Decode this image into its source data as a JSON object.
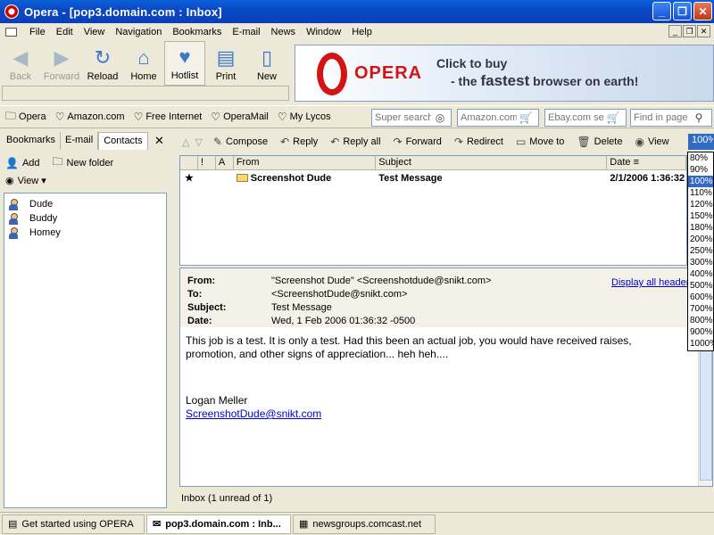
{
  "window": {
    "title": "Opera - [pop3.domain.com : Inbox]",
    "controls": [
      "_",
      "❐",
      "✕"
    ]
  },
  "menu": {
    "items": [
      "File",
      "Edit",
      "View",
      "Navigation",
      "Bookmarks",
      "E-mail",
      "News",
      "Window",
      "Help"
    ],
    "mdi_controls": [
      "_",
      "❐",
      "✕"
    ]
  },
  "toolbar": {
    "buttons": [
      {
        "label": "Back",
        "icon": "◀"
      },
      {
        "label": "Forward",
        "icon": "▶"
      },
      {
        "label": "Reload",
        "icon": "↻"
      },
      {
        "label": "Home",
        "icon": "⌂"
      },
      {
        "label": "Hotlist",
        "icon": "♥"
      },
      {
        "label": "Print",
        "icon": "▤"
      },
      {
        "label": "New",
        "icon": "▯"
      }
    ]
  },
  "banner": {
    "brand": "OPERA",
    "line1": "Click to buy",
    "line2_prefix": "- the",
    "line2_bold": "fastest",
    "line2_suffix": "browser on earth!"
  },
  "personal_bar": {
    "items": [
      "Opera",
      "Amazon.com",
      "Free Internet",
      "OperaMail",
      "My Lycos"
    ],
    "searches": [
      {
        "placeholder": "Super search"
      },
      {
        "placeholder": "Amazon.com"
      },
      {
        "placeholder": "Ebay.com se"
      },
      {
        "placeholder": "Find in page"
      }
    ]
  },
  "panel": {
    "tabs": [
      "Bookmarks",
      "E-mail",
      "Contacts"
    ],
    "active_tab": "Contacts",
    "close": "✕",
    "actions": [
      "Add",
      "New folder"
    ],
    "view_label": "View ▾",
    "contacts": [
      "Dude",
      "Buddy",
      "Homey"
    ]
  },
  "mail_toolbar": {
    "buttons": [
      {
        "label": "Compose",
        "icon": "✎"
      },
      {
        "label": "Reply",
        "icon": "↶"
      },
      {
        "label": "Reply all",
        "icon": "↶"
      },
      {
        "label": "Forward",
        "icon": "↷"
      },
      {
        "label": "Redirect",
        "icon": "↷"
      },
      {
        "label": "Move to",
        "icon": "▭"
      },
      {
        "label": "Delete",
        "icon": "🗑"
      },
      {
        "label": "View",
        "icon": "◉"
      }
    ]
  },
  "zoom": {
    "value": "100%",
    "options": [
      "80%",
      "90%",
      "100%",
      "110%",
      "120%",
      "150%",
      "180%",
      "200%",
      "250%",
      "300%",
      "400%",
      "500%",
      "600%",
      "700%",
      "800%",
      "900%",
      "1000%"
    ],
    "selected": "100%"
  },
  "message_list": {
    "columns": [
      "",
      "!",
      "A",
      "From",
      "Subject",
      "Date ≡"
    ],
    "rows": [
      {
        "star": "★",
        "from": "Screenshot Dude",
        "subject": "Test Message",
        "date": "2/1/2006 1:36:32"
      }
    ]
  },
  "message": {
    "from_label": "From:",
    "from": "\"Screenshot Dude\" <Screenshotdude@snikt.com>",
    "to_label": "To:",
    "to": "<ScreenshotDude@snikt.com>",
    "subject_label": "Subject:",
    "subject": "Test Message",
    "date_label": "Date:",
    "date": "Wed, 1 Feb 2006 01:36:32 -0500",
    "display_all": "Display all headers",
    "body_line1": "This job is a test.  It is only a test.  Had this been an actual job, you would have received raises,",
    "body_line2": "promotion, and other signs of appreciation... heh heh....",
    "signature_name": "Logan Meller",
    "signature_email": "ScreenshotDude@snikt.com"
  },
  "status": "Inbox (1 unread of 1)",
  "bottom_tabs": [
    {
      "label": "Get started using OPERA",
      "icon": "▤",
      "active": false
    },
    {
      "label": "pop3.domain.com : Inb...",
      "icon": "✉",
      "active": true
    },
    {
      "label": "newsgroups.comcast.net",
      "icon": "▦",
      "active": false
    }
  ]
}
